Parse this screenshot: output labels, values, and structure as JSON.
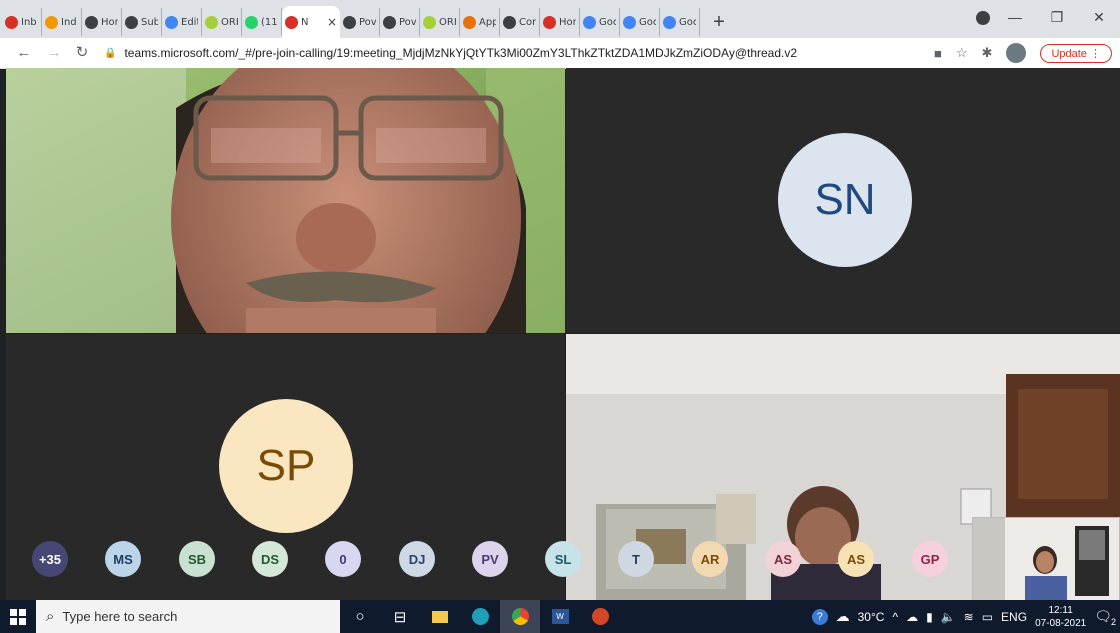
{
  "browser": {
    "tabs": [
      {
        "title": "Inb",
        "icon": "gmail-icon",
        "color": "#d93025"
      },
      {
        "title": "Ind",
        "icon": "ring-icon",
        "color": "#f29900"
      },
      {
        "title": "Hor",
        "icon": "globe-icon",
        "color": "#3c4043"
      },
      {
        "title": "Sub",
        "icon": "globe-icon",
        "color": "#3c4043"
      },
      {
        "title": "Edit",
        "icon": "edit-icon",
        "color": "#4285f4"
      },
      {
        "title": "ORI",
        "icon": "orcid-icon",
        "color": "#a6ce39"
      },
      {
        "title": "(11)",
        "icon": "whatsapp-icon",
        "color": "#25d366"
      },
      {
        "title": "N",
        "icon": "record-icon",
        "color": "#d93025"
      },
      {
        "title": "Pov",
        "icon": "globe-icon",
        "color": "#3c4043"
      },
      {
        "title": "Pov",
        "icon": "globe-icon",
        "color": "#3c4043"
      },
      {
        "title": "ORI",
        "icon": "orcid-icon",
        "color": "#a6ce39"
      },
      {
        "title": "App",
        "icon": "e-icon",
        "color": "#e8710a"
      },
      {
        "title": "Cor",
        "icon": "globe-icon",
        "color": "#3c4043"
      },
      {
        "title": "Hor",
        "icon": "record-icon",
        "color": "#d93025"
      },
      {
        "title": "Goo",
        "icon": "google-icon",
        "color": "#4285f4"
      },
      {
        "title": "Goo",
        "icon": "google-icon",
        "color": "#4285f4"
      },
      {
        "title": "Goo",
        "icon": "google-icon",
        "color": "#4285f4"
      }
    ],
    "active_tab_index": 7,
    "url": "teams.microsoft.com/_#/pre-join-calling/19:meeting_MjdjMzNkYjQtYTk3Mi00ZmY3LThkZTktZDA1MDJkZmZiODAy@thread.v2",
    "update_label": "Update"
  },
  "meeting": {
    "tiles": [
      {
        "id": "tl",
        "type": "video"
      },
      {
        "id": "tr",
        "type": "avatar",
        "initials": "SN",
        "bg": "#dce4ef",
        "fg": "#204a7e"
      },
      {
        "id": "bl",
        "type": "avatar",
        "initials": "SP",
        "bg": "#fbe6c2",
        "fg": "#7a4b05"
      },
      {
        "id": "br",
        "type": "video"
      }
    ],
    "participants": [
      {
        "label": "+35",
        "bg": "#464775",
        "fg": "#ffffff"
      },
      {
        "label": "MS",
        "bg": "#bcd4ea",
        "fg": "#1a3e66"
      },
      {
        "label": "SB",
        "bg": "#c9e1d0",
        "fg": "#1f5a34"
      },
      {
        "label": "DS",
        "bg": "#d5e7d7",
        "fg": "#1f5a34"
      },
      {
        "label": "0",
        "bg": "#d8d6f0",
        "fg": "#3b3a75"
      },
      {
        "label": "DJ",
        "bg": "#cfd9e6",
        "fg": "#27456a"
      },
      {
        "label": "PV",
        "bg": "#dcd3ec",
        "fg": "#4b3a75"
      },
      {
        "label": "SL",
        "bg": "#c6e3ea",
        "fg": "#1c5a68"
      },
      {
        "label": "T",
        "bg": "#cfd8e2",
        "fg": "#2a3f55"
      },
      {
        "label": "AR",
        "bg": "#f3d9b1",
        "fg": "#7a4b05"
      },
      {
        "label": "AS",
        "bg": "#f1d2d7",
        "fg": "#7d2a3a"
      },
      {
        "label": "AS",
        "bg": "#f7e2b6",
        "fg": "#7a4b05"
      },
      {
        "label": "GP",
        "bg": "#f6d1dd",
        "fg": "#8a2448"
      }
    ]
  },
  "taskbar": {
    "search_placeholder": "Type here to search",
    "weather": "30°C",
    "language": "ENG",
    "time": "12:11",
    "date": "07-08-2021",
    "notification_count": "2"
  }
}
